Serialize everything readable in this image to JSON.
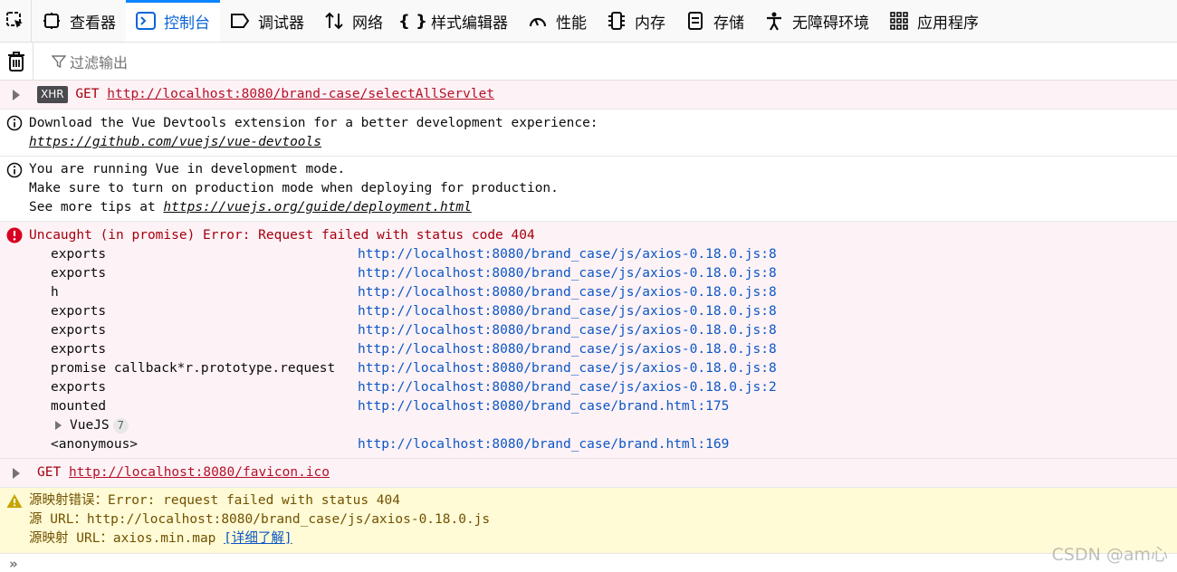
{
  "toolbar": {
    "tabs": [
      {
        "label": "查看器",
        "icon": "inspector-icon"
      },
      {
        "label": "控制台",
        "icon": "console-icon"
      },
      {
        "label": "调试器",
        "icon": "debugger-icon"
      },
      {
        "label": "网络",
        "icon": "network-icon"
      },
      {
        "label": "样式编辑器",
        "icon": "style-editor-icon"
      },
      {
        "label": "性能",
        "icon": "performance-icon"
      },
      {
        "label": "内存",
        "icon": "memory-icon"
      },
      {
        "label": "存储",
        "icon": "storage-icon"
      },
      {
        "label": "无障碍环境",
        "icon": "accessibility-icon"
      },
      {
        "label": "应用程序",
        "icon": "application-icon"
      }
    ],
    "active_tab": "控制台"
  },
  "filter": {
    "placeholder": "过滤输出"
  },
  "messages": {
    "xhr1": {
      "badge": "XHR",
      "method": "GET",
      "url": "http://localhost:8080/brand-case/selectAllServlet"
    },
    "info1": {
      "line1": "Download the Vue Devtools extension for a better development experience:",
      "link": "https://github.com/vuejs/vue-devtools"
    },
    "info2": {
      "line1": "You are running Vue in development mode.",
      "line2": "Make sure to turn on production mode when deploying for production.",
      "line3_prefix": "See more tips at ",
      "link": "https://vuejs.org/guide/deployment.html"
    },
    "error": {
      "title": "Uncaught (in promise) Error: Request failed with status code 404",
      "stack": [
        {
          "fn": "exports",
          "loc": "http://localhost:8080/brand_case/js/axios-0.18.0.js:8"
        },
        {
          "fn": "exports",
          "loc": "http://localhost:8080/brand_case/js/axios-0.18.0.js:8"
        },
        {
          "fn": "h",
          "loc": "http://localhost:8080/brand_case/js/axios-0.18.0.js:8"
        },
        {
          "fn": "exports",
          "loc": "http://localhost:8080/brand_case/js/axios-0.18.0.js:8"
        },
        {
          "fn": "exports",
          "loc": "http://localhost:8080/brand_case/js/axios-0.18.0.js:8"
        },
        {
          "fn": "exports",
          "loc": "http://localhost:8080/brand_case/js/axios-0.18.0.js:8"
        },
        {
          "fn": "promise callback*r.prototype.request",
          "loc": "http://localhost:8080/brand_case/js/axios-0.18.0.js:8"
        },
        {
          "fn": "exports",
          "loc": "http://localhost:8080/brand_case/js/axios-0.18.0.js:2"
        },
        {
          "fn": "mounted",
          "loc": "http://localhost:8080/brand_case/brand.html:175"
        }
      ],
      "group": {
        "label": "VueJS",
        "count": "7"
      },
      "last": {
        "fn": "<anonymous>",
        "loc": "http://localhost:8080/brand_case/brand.html:169"
      }
    },
    "xhr2": {
      "method": "GET",
      "url": "http://localhost:8080/favicon.ico"
    },
    "warning": {
      "line1": "源映射错误：Error: request failed with status 404",
      "line2": "源 URL：http://localhost:8080/brand_case/js/axios-0.18.0.js",
      "line3_prefix": "源映射 URL：axios.min.map ",
      "link": "[详细了解]"
    }
  },
  "watermark": "CSDN @am心",
  "colors": {
    "accent": "#0a84ff",
    "error_bg": "#fdf2f5",
    "error_text": "#a4000f",
    "warn_bg": "#fffbd6",
    "warn_text": "#715100",
    "link_blue": "#0b56c6"
  }
}
